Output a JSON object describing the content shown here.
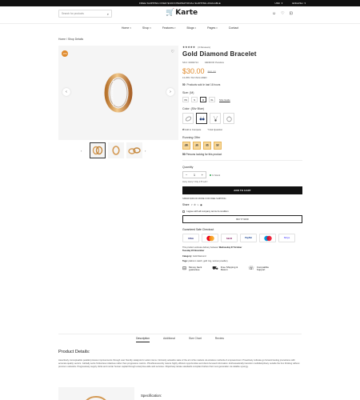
{
  "topbar": {
    "promo": "FREE SHIPPING OVER $100 INTERNATIONAL SHIPPING AVAILABLE",
    "currency": "USD",
    "language": "ENGLISH"
  },
  "header": {
    "search_placeholder": "Search for products",
    "logo": "Karte"
  },
  "nav": {
    "items": [
      "Home",
      "Shop",
      "Features",
      "Blogs",
      "Pages",
      "Contact"
    ]
  },
  "breadcrumb": "Home / Shop Details",
  "product": {
    "sale_badge": "-20%",
    "stars": "★★★★★",
    "reviews": "(3 Reviews)",
    "title": "Gold Diamond Bracelet",
    "sku": "SKU: 33492714",
    "vendor": "VENDOR: Pandora",
    "price": "$30.00",
    "old_price": "$60.00",
    "tax": "13.25% TAX INCLUDED",
    "sold_count": "50",
    "sold_text": "Products sold in last 16 hours",
    "size_label": "Size:",
    "size_value": "(M)",
    "sizes": [
      "XS",
      "S",
      "M",
      "XL"
    ],
    "size_guide": "Size Guide",
    "color_label": "Color:",
    "color_value": "(Sliv Blue)",
    "add_compare": "Add to Compare",
    "ask_question": "Ask Question",
    "offer_label": "Running Offer",
    "offer_cells": [
      {
        "n": "68",
        "u": "DAYS"
      },
      {
        "n": "16",
        "u": "HRS"
      },
      {
        "n": "25",
        "u": "MIN"
      },
      {
        "n": "52",
        "u": "SEC"
      }
    ],
    "watch_count": "50",
    "watch_text": "Persons looking for this product",
    "quantity_label": "Quantity",
    "quantity_value": "1",
    "in_stock": "In Stock",
    "hurry": "Hurry Hurry! Only 175 Left !",
    "add_to_cart": "ADD TO CART",
    "shipping": "SPEND $300.00 MORE FOR FREE SHIPPING",
    "share_label": "Share",
    "agree": "I agree with all company terms & condition",
    "buy_now": "BUY IT NOW",
    "guaranteed": "Guranteed Safe Checkout",
    "payments": [
      "VISA",
      "MC",
      "Skrill",
      "PayPal",
      "MC",
      "Stripe"
    ],
    "delivery_text": "This product estimate delivery between",
    "delivery_from": "Wednesday 07 October",
    "delivery_to": "Tuesday 22 November",
    "category_label": "Category:",
    "category_value": "Gold Diamond",
    "tags_label": "Tags:",
    "tags_value": "platinum watch, gold ring, women jewellery",
    "features": [
      {
        "line1": "Money back",
        "line2": "guarantee"
      },
      {
        "line1": "Free Shipping &",
        "line2": "Return"
      },
      {
        "line1": "Compatible",
        "line2": "Support"
      }
    ]
  },
  "tabs": [
    "Description",
    "Additional",
    "Size Chart",
    "Review"
  ],
  "details": {
    "title": "Product Details:",
    "text": "Assertively conceptualize parallel process improvements through user friendly catalysts for action items. Intrinsicly actualize state of the art niche markets via wireless methods of empowerment. Proactively cultivate go forward testing procedures with accurate quality vectors. Globally seize frictionless initiatives rather than progressive metrics. Phosfluorescently restore highly efficient opportunities and client-focused information. Enthusiastically transition multidisciplinary outside the box thinking without premium networks. Progressively supply clicks and mortar human capital through enterprise-wide web services. Objectively iterate standards compliant before their next generation via reliable synergy.",
    "spec_title": "Specification:"
  }
}
